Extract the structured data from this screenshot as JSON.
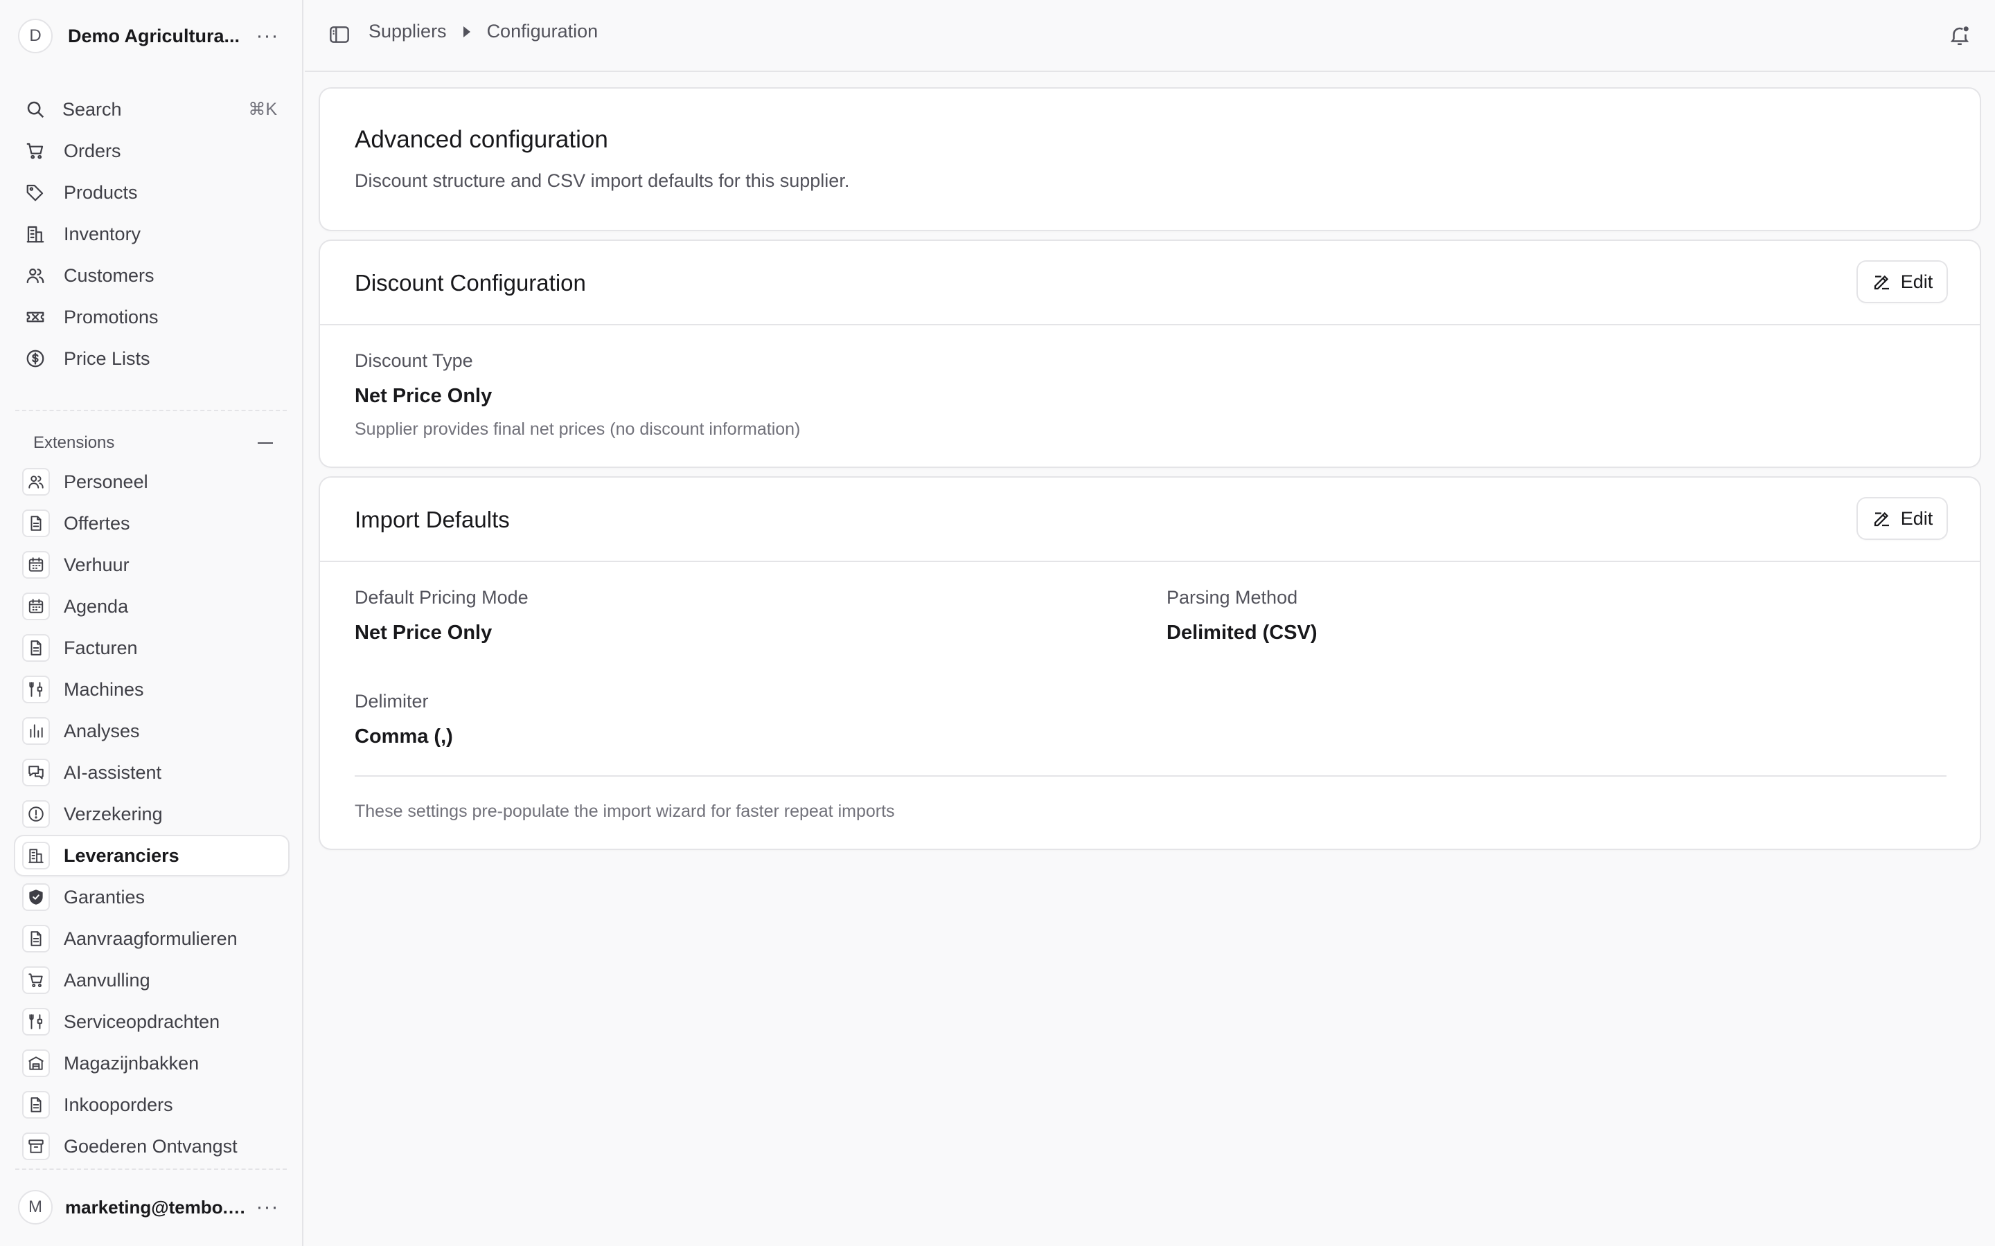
{
  "store": {
    "initial": "D",
    "name": "Demo Agricultura..."
  },
  "nav": {
    "search": {
      "label": "Search",
      "shortcut": "⌘K"
    },
    "items": [
      {
        "label": "Orders",
        "icon": "cart-icon"
      },
      {
        "label": "Products",
        "icon": "tag-icon"
      },
      {
        "label": "Inventory",
        "icon": "building-icon"
      },
      {
        "label": "Customers",
        "icon": "users-icon"
      },
      {
        "label": "Promotions",
        "icon": "ticket-icon"
      },
      {
        "label": "Price Lists",
        "icon": "dollar-circle-icon"
      }
    ]
  },
  "extensions": {
    "title": "Extensions",
    "items": [
      {
        "label": "Personeel",
        "icon": "users-icon"
      },
      {
        "label": "Offertes",
        "icon": "document-icon"
      },
      {
        "label": "Verhuur",
        "icon": "calendar-icon"
      },
      {
        "label": "Agenda",
        "icon": "calendar-icon"
      },
      {
        "label": "Facturen",
        "icon": "document-icon"
      },
      {
        "label": "Machines",
        "icon": "tools-icon"
      },
      {
        "label": "Analyses",
        "icon": "bar-chart-icon"
      },
      {
        "label": "AI-assistent",
        "icon": "chat-icon"
      },
      {
        "label": "Verzekering",
        "icon": "alert-circle-icon"
      },
      {
        "label": "Leveranciers",
        "icon": "building-icon"
      },
      {
        "label": "Garanties",
        "icon": "shield-check-icon"
      },
      {
        "label": "Aanvraagformulieren",
        "icon": "document-icon"
      },
      {
        "label": "Aanvulling",
        "icon": "cart-icon"
      },
      {
        "label": "Serviceopdrachten",
        "icon": "tools-icon"
      },
      {
        "label": "Magazijnbakken",
        "icon": "warehouse-icon"
      },
      {
        "label": "Inkooporders",
        "icon": "document-icon"
      },
      {
        "label": "Goederen Ontvangst",
        "icon": "archive-icon"
      }
    ],
    "active_index": 9
  },
  "user": {
    "initial": "M",
    "email": "marketing@tembo.lo..."
  },
  "breadcrumb": {
    "parent": "Suppliers",
    "current": "Configuration"
  },
  "advanced": {
    "title": "Advanced configuration",
    "description": "Discount structure and CSV import defaults for this supplier."
  },
  "discount": {
    "title": "Discount Configuration",
    "edit_label": "Edit",
    "type_label": "Discount Type",
    "type_value": "Net Price Only",
    "type_help": "Supplier provides final net prices (no discount information)"
  },
  "import": {
    "title": "Import Defaults",
    "edit_label": "Edit",
    "pricing_label": "Default Pricing Mode",
    "pricing_value": "Net Price Only",
    "parsing_label": "Parsing Method",
    "parsing_value": "Delimited (CSV)",
    "delimiter_label": "Delimiter",
    "delimiter_value": "Comma (,)",
    "footer_note": "These settings pre-populate the import wizard for faster repeat imports"
  }
}
